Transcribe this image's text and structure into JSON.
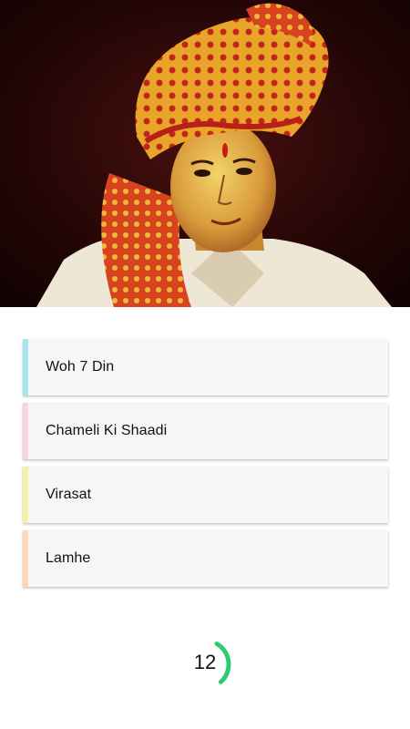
{
  "question_image": {
    "description_icon": "portrait-image"
  },
  "options": [
    {
      "label": "Woh 7 Din",
      "accent": "#a8e6ef"
    },
    {
      "label": "Chameli Ki Shaadi",
      "accent": "#fbd3e6"
    },
    {
      "label": "Virasat",
      "accent": "#f1f3a6"
    },
    {
      "label": "Lamhe",
      "accent": "#fdd8b8"
    }
  ],
  "timer": {
    "count": "12",
    "progress": 0.3,
    "color": "#2ecc71"
  }
}
